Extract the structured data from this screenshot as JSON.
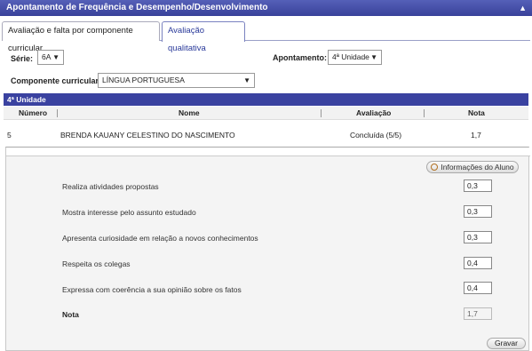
{
  "header": {
    "title": "Apontamento de Frequência e Desempenho/Desenvolvimento",
    "collapse_icon": "▲"
  },
  "tabs": [
    {
      "label": "Avaliação e falta por componente curricular",
      "active": false
    },
    {
      "label": "Avaliação qualitativa",
      "active": true
    }
  ],
  "filters": {
    "serie_label": "Série:",
    "serie_value": "6A",
    "apontamento_label": "Apontamento:",
    "apontamento_value": "4ª Unidade",
    "componente_label": "Componente curricular:",
    "componente_value": "LÍNGUA PORTUGUESA",
    "dropdown_arrow": "▼"
  },
  "unit_bar": {
    "title": "4ª Unidade"
  },
  "table": {
    "headers": {
      "numero": "Número",
      "nome": "Nome",
      "avaliacao": "Avaliação",
      "nota": "Nota"
    },
    "row": {
      "numero": "5",
      "nome": "BRENDA KAUANY CELESTINO DO NASCIMENTO",
      "avaliacao": "Concluída (5/5)",
      "nota": "1,7"
    }
  },
  "panel": {
    "info_button": "Informações do Aluno",
    "criteria": [
      {
        "label": "Realiza atividades propostas",
        "value": "0,3"
      },
      {
        "label": "Mostra interesse pelo assunto estudado",
        "value": "0,3"
      },
      {
        "label": "Apresenta curiosidade em relação a novos conhecimentos",
        "value": "0,3"
      },
      {
        "label": "Respeita os colegas",
        "value": "0,4"
      },
      {
        "label": "Expressa com coerência a sua opinião sobre os fatos",
        "value": "0,4"
      }
    ],
    "nota_label": "Nota",
    "nota_value": "1,7"
  },
  "save_button": "Gravar"
}
